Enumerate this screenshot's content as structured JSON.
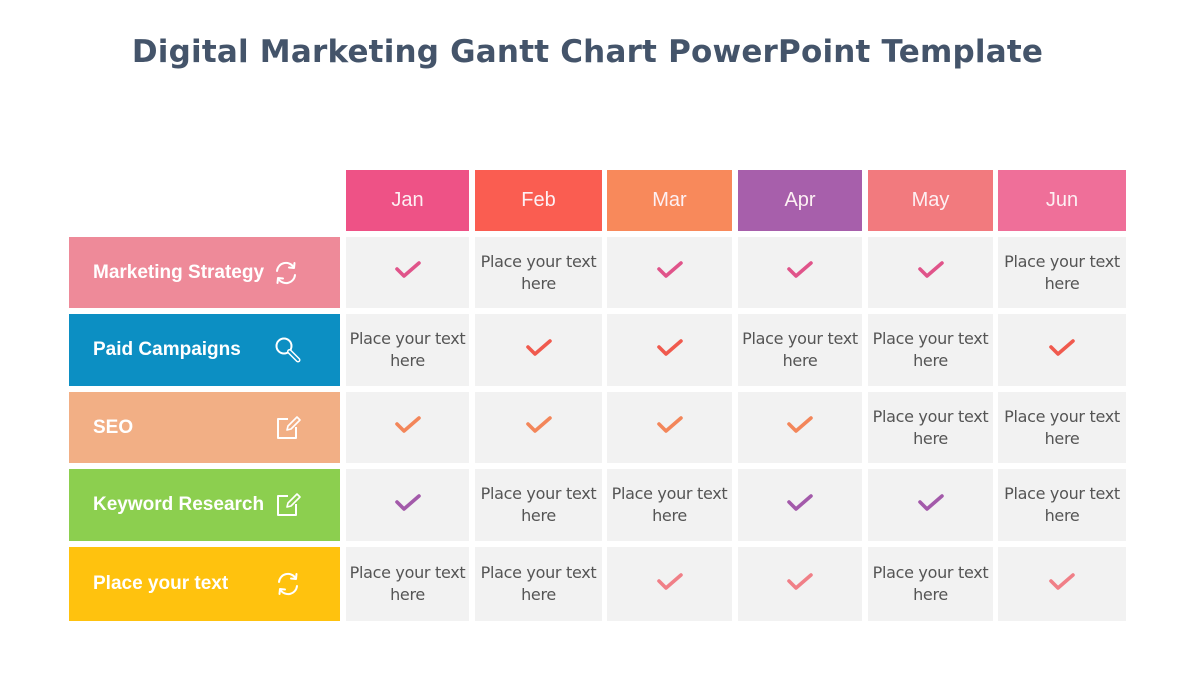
{
  "title": "Digital Marketing Gantt Chart PowerPoint Template",
  "colors": {
    "title": "#44546a",
    "cell_bg": "#f2f2f2",
    "cell_text": "#555555"
  },
  "chart_data": {
    "type": "table",
    "title": "Digital Marketing Gantt Chart PowerPoint Template",
    "months": [
      {
        "label": "Jan",
        "color": "#ee5286"
      },
      {
        "label": "Feb",
        "color": "#fa5d51"
      },
      {
        "label": "Mar",
        "color": "#f8895b"
      },
      {
        "label": "Apr",
        "color": "#a75fab"
      },
      {
        "label": "May",
        "color": "#f27a7e"
      },
      {
        "label": "Jun",
        "color": "#ef6f99"
      }
    ],
    "tasks": [
      {
        "label": "Marketing Strategy",
        "icon": "refresh-icon",
        "color": "#ee8a99",
        "check_color": "#e0548a",
        "cells": [
          "check",
          "Place your text here",
          "check",
          "check",
          "check",
          "Place your text here"
        ]
      },
      {
        "label": "Paid Campaigns",
        "icon": "search-icon",
        "color": "#0c8fc3",
        "check_color": "#f05a4e",
        "cells": [
          "Place your text here",
          "check",
          "check",
          "Place your text here",
          "Place your text here",
          "check"
        ]
      },
      {
        "label": "SEO",
        "icon": "edit-icon",
        "color": "#f2af85",
        "check_color": "#f3865a",
        "cells": [
          "check",
          "check",
          "check",
          "check",
          "Place your text here",
          "Place your text here"
        ]
      },
      {
        "label": "Keyword Research",
        "icon": "edit-icon",
        "color": "#8ccf4f",
        "check_color": "#a35aaa",
        "cells": [
          "check",
          "Place your text here",
          "Place your text here",
          "check",
          "check",
          "Place your text here"
        ]
      },
      {
        "label": "Place your text",
        "icon": "refresh-icon",
        "color": "#ffc20e",
        "check_color": "#f07f87",
        "cells": [
          "Place your text here",
          "Place your text here",
          "check",
          "check",
          "Place your text here",
          "check"
        ]
      }
    ]
  }
}
